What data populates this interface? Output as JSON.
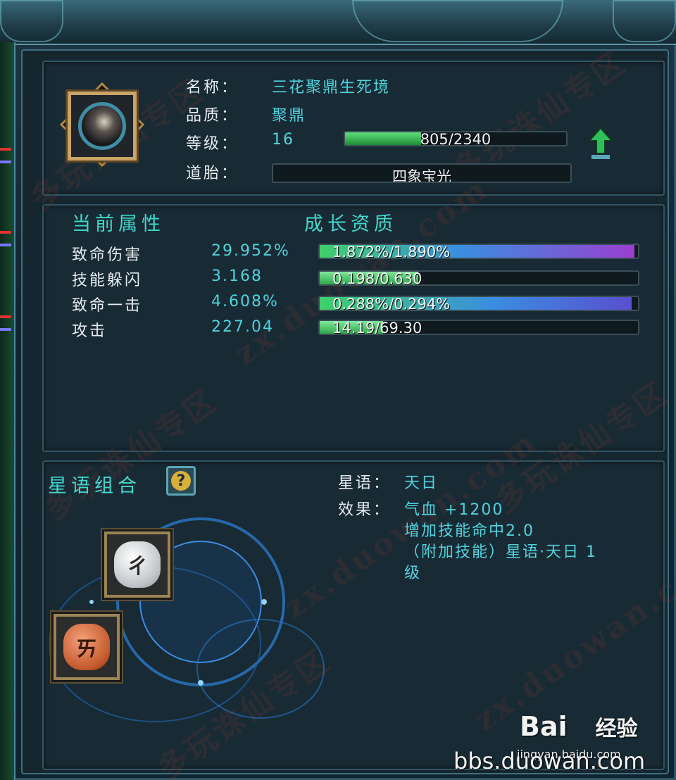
{
  "item": {
    "name_label": "名称：",
    "name_value": "三花聚鼎生死境",
    "quality_label": "品质：",
    "quality_value": "聚鼎",
    "level_label": "等级：",
    "level_value": "16",
    "exp_text": "805/2340",
    "exp_fraction": 0.344,
    "dao_label": "道胎：",
    "dao_value": "四象宝光",
    "icon": "orb-icon",
    "upgrade_icon": "up-arrow-icon"
  },
  "attributes": {
    "current_title": "当前属性",
    "growth_title": "成长资质",
    "rows": [
      {
        "name": "致命伤害",
        "value": "29.952%",
        "growth": "1.872%/1.890%",
        "fraction": 0.99,
        "color": "purple"
      },
      {
        "name": "技能躲闪",
        "value": "3.168",
        "growth": "0.198/0.630",
        "fraction": 0.31,
        "color": "green"
      },
      {
        "name": "致命一击",
        "value": "4.608%",
        "growth": "0.288%/0.294%",
        "fraction": 0.98,
        "color": "blue"
      },
      {
        "name": "攻击",
        "value": "227.04",
        "growth": "14.19/69.30",
        "fraction": 0.2,
        "color": "green"
      }
    ]
  },
  "star": {
    "title": "星语组合",
    "help_icon": "question-icon",
    "star_label": "星语：",
    "star_value": "天日",
    "effect_label": "效果：",
    "effect_lines": [
      "气血 +1200",
      "增加技能命中2.0",
      "（附加技能）星语·天日 1",
      "级"
    ],
    "runes": [
      {
        "icon": "white-rune-icon",
        "glyph": "ㄔ"
      },
      {
        "icon": "orange-rune-icon",
        "glyph": "ㄞ"
      }
    ]
  },
  "watermark": {
    "cn": "多玩诛仙专区",
    "url": "zx.duowan.com"
  },
  "brand": {
    "logo": "Bai",
    "logo2": "经验",
    "sub": "jingyan.baidu.com",
    "bbs": "bbs.duowan.com"
  },
  "colors": {
    "cyan": "#4fd3dd",
    "bar_green": "#2fb34a",
    "bar_blue": "#3a7fe0",
    "bar_purple": "#9a3fd0"
  }
}
